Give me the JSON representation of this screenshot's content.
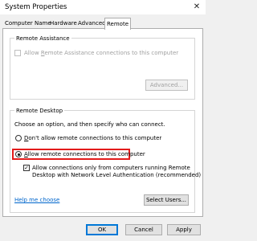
{
  "window": {
    "title": "System Properties",
    "close_icon": "close-icon"
  },
  "tabs": [
    {
      "label": "Computer Name"
    },
    {
      "label": "Hardware"
    },
    {
      "label": "Advanced"
    },
    {
      "label": "Remote",
      "selected": true
    }
  ],
  "remote_assistance": {
    "group_label": "Remote Assistance",
    "allow_label_pre": "Allow ",
    "allow_label_u": "R",
    "allow_label_post": "emote Assistance connections to this computer",
    "allow_checked": false,
    "advanced_label": "Advanced..."
  },
  "remote_desktop": {
    "group_label": "Remote Desktop",
    "instruction": "Choose an option, and then specify who can connect.",
    "option_dont": {
      "pre": "",
      "u": "D",
      "post": "on't allow remote connections to this computer",
      "selected": false
    },
    "option_allow": {
      "pre": "",
      "u": "A",
      "post": "llow remote connections to this computer",
      "selected": true
    },
    "nla_line1": "Allow connections only from computers running Remote",
    "nla_line2": "Desktop with Network Level Authentication (recommended)",
    "nla_checked": true,
    "help_link": "Help me choose",
    "select_users_label": "Select Users..."
  },
  "footer": {
    "ok": "OK",
    "cancel": "Cancel",
    "apply": "Apply"
  },
  "colors": {
    "highlight": "#e31b1b",
    "link": "#0066cc",
    "default_button_border": "#0078d7"
  }
}
